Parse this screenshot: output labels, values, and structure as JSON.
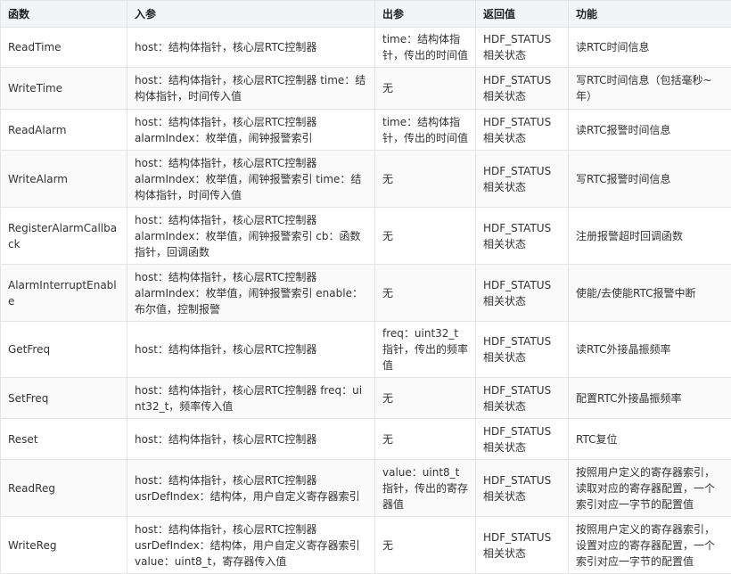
{
  "headers": [
    "函数",
    "入参",
    "出参",
    "返回值",
    "功能"
  ],
  "rows": [
    {
      "fn": "ReadTime",
      "in": "host：结构体指针，核心层RTC控制器",
      "out": "time：结构体指针，传出的时间值",
      "ret": "HDF_STATUS相关状态",
      "desc": "读RTC时间信息",
      "h": 45
    },
    {
      "fn": "WriteTime",
      "in": "host：结构体指针，核心层RTC控制器 time：结构体指针，时间传入值",
      "out": "无",
      "ret": "HDF_STATUS相关状态",
      "desc": "写RTC时间信息（包括毫秒~年）",
      "h": 47
    },
    {
      "fn": "ReadAlarm",
      "in": "host：结构体指针，核心层RTC控制器\nalarmIndex：枚举值，闹钟报警索引",
      "out": "time：结构体指针，传出的时间值",
      "ret": "HDF_STATUS相关状态",
      "desc": "读RTC报警时间信息",
      "h": 46
    },
    {
      "fn": "WriteAlarm",
      "in": "host：结构体指针，核心层RTC控制器\nalarmIndex：枚举值，闹钟报警索引 time：结构体指针，时间传入值",
      "out": "无",
      "ret": "HDF_STATUS相关状态",
      "desc": "写RTC报警时间信息",
      "h": 64
    },
    {
      "fn": "RegisterAlarmCallback",
      "in": "host：结构体指针，核心层RTC控制器\nalarmIndex：枚举值，闹钟报警索引 cb：函数指针，回调函数",
      "out": "无",
      "ret": "HDF_STATUS相关状态",
      "desc": "注册报警超时回调函数",
      "h": 64
    },
    {
      "fn": "AlarmInterruptEnable",
      "in": "host：结构体指针，核心层RTC控制器\nalarmIndex：枚举值，闹钟报警索引 enable：布尔值，控制报警",
      "out": "无",
      "ret": "HDF_STATUS相关状态",
      "desc": "使能/去使能RTC报警中断",
      "h": 64
    },
    {
      "fn": "GetFreq",
      "in": "host：结构体指针，核心层RTC控制器",
      "out": "freq：uint32_t指针，传出的频率值",
      "ret": "HDF_STATUS相关状态",
      "desc": "读RTC外接晶振频率",
      "h": 46
    },
    {
      "fn": "SetFreq",
      "in": "host：结构体指针，核心层RTC控制器 freq：uint32_t，频率传入值",
      "out": "无",
      "ret": "HDF_STATUS相关状态",
      "desc": "配置RTC外接晶振频率",
      "h": 46
    },
    {
      "fn": "Reset",
      "in": "host：结构体指针，核心层RTC控制器",
      "out": "无",
      "ret": "HDF_STATUS相关状态",
      "desc": "RTC复位",
      "h": 46
    },
    {
      "fn": "ReadReg",
      "in": "host：结构体指针，核心层RTC控制器\nusrDefIndex：结构体，用户自定义寄存器索引",
      "out": "value：uint8_t指针，传出的寄存器值",
      "ret": "HDF_STATUS相关状态",
      "desc": "按照用户定义的寄存器索引，读取对应的寄存器配置，一个索引对应一字节的配置值",
      "h": 64
    },
    {
      "fn": "WriteReg",
      "in": "host：结构体指针，核心层RTC控制器\nusrDefIndex：结构体，用户自定义寄存器索引\nvalue：uint8_t，寄存器传入值",
      "out": "无",
      "ret": "HDF_STATUS相关状态",
      "desc": "按照用户定义的寄存器索引，设置对应的寄存器配置，一个索引对应一字节的配置值",
      "h": 64
    }
  ]
}
